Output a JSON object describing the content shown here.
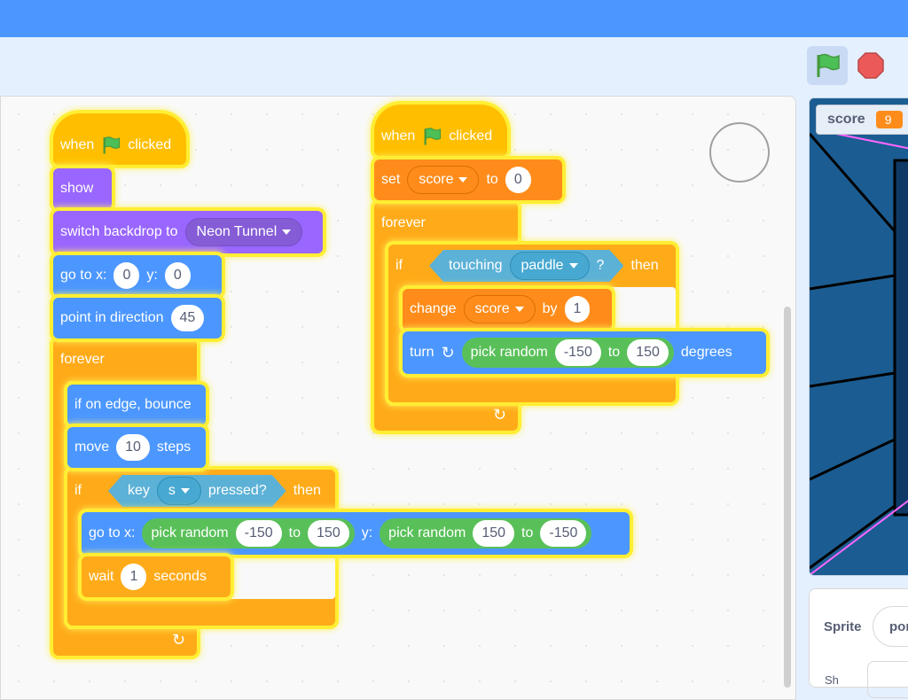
{
  "toolbar": {
    "green_flag": "green-flag-icon",
    "stop": "stop-icon"
  },
  "monitor": {
    "label": "score",
    "value": "9"
  },
  "sprite": {
    "label": "Sprite",
    "name": "pong",
    "partial_label": "Sh"
  },
  "script1": {
    "hat_when": "when",
    "hat_clicked": "clicked",
    "show": "show",
    "switch_backdrop": "switch backdrop to",
    "backdrop": "Neon Tunnel",
    "goto": "go to x:",
    "goto_x": "0",
    "goto_y_label": "y:",
    "goto_y": "0",
    "point": "point in direction",
    "point_val": "45",
    "forever": "forever",
    "bounce": "if on edge, bounce",
    "move": "move",
    "move_val": "10",
    "steps": "steps",
    "if": "if",
    "key": "key",
    "key_val": "s",
    "pressed": "pressed?",
    "then": "then",
    "goto2": "go to x:",
    "pick1": "pick random",
    "p1a": "-150",
    "to1": "to",
    "p1b": "150",
    "y2": "y:",
    "pick2": "pick random",
    "p2a": "150",
    "to2": "to",
    "p2b": "-150",
    "wait": "wait",
    "wait_val": "1",
    "seconds": "seconds"
  },
  "script2": {
    "hat_when": "when",
    "hat_clicked": "clicked",
    "set": "set",
    "var": "score",
    "to": "to",
    "set_val": "0",
    "forever": "forever",
    "if": "if",
    "touching": "touching",
    "touch_obj": "paddle",
    "q": "?",
    "then": "then",
    "change": "change",
    "change_var": "score",
    "by": "by",
    "change_val": "1",
    "turn": "turn",
    "pick": "pick random",
    "pa": "-150",
    "to2": "to",
    "pb": "150",
    "degrees": "degrees"
  },
  "colors": {
    "motion": "#4c97ff",
    "events": "#ffbf00",
    "control": "#ffab19",
    "looks": "#9966ff",
    "variables": "#ff8c1a",
    "operators": "#59c059",
    "sensing": "#5cb1d6",
    "highlight": "#ffee33"
  }
}
